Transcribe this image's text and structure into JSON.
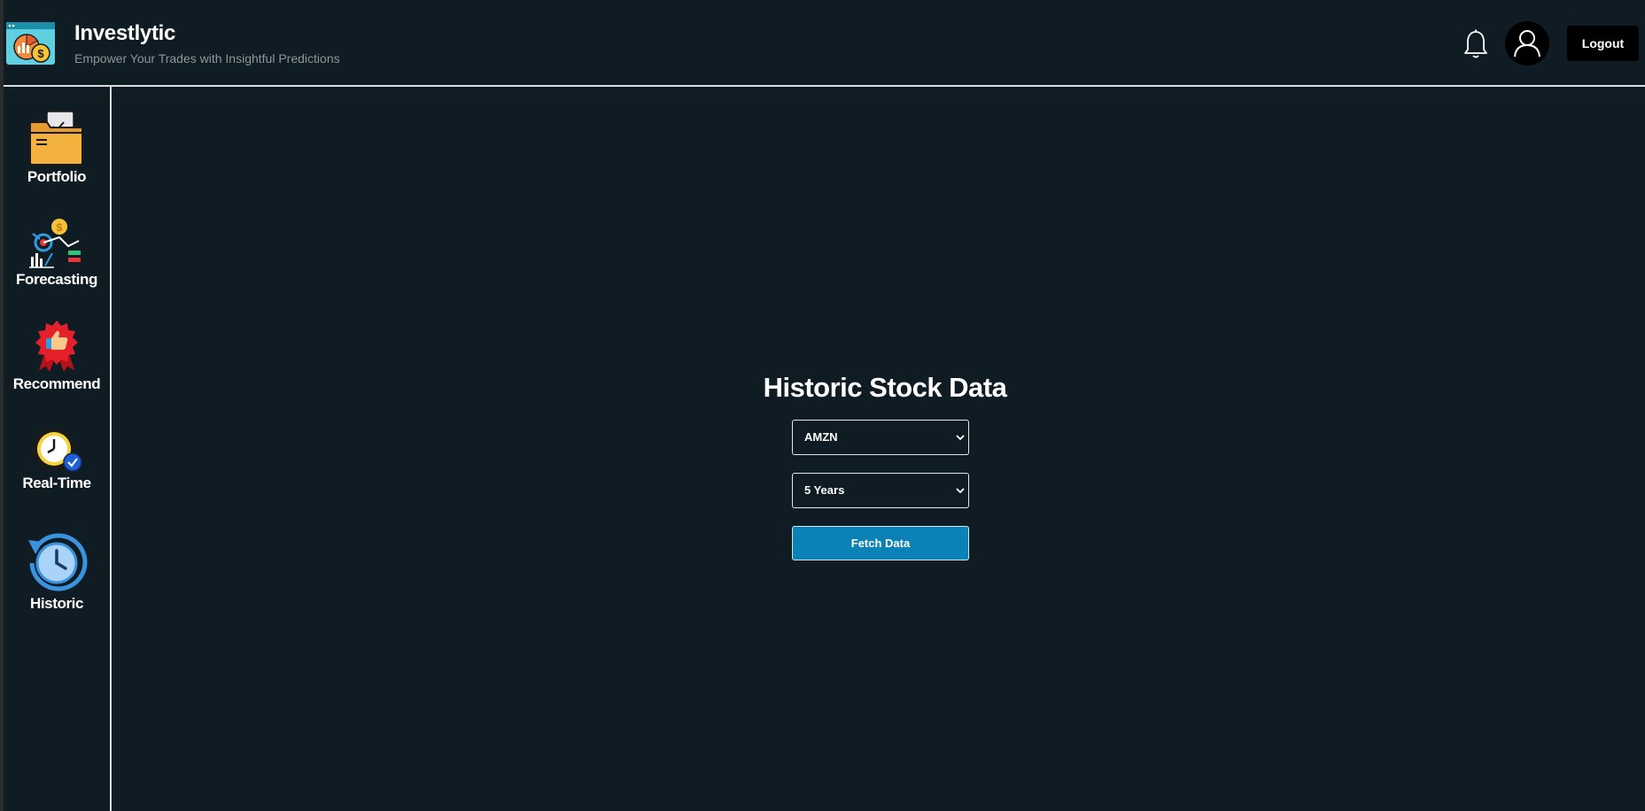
{
  "header": {
    "title": "Investlytic",
    "subtitle": "Empower Your Trades with Insightful Predictions",
    "logout_label": "Logout"
  },
  "sidebar": {
    "items": [
      {
        "label": "Portfolio",
        "icon": "folder-icon"
      },
      {
        "label": "Forecasting",
        "icon": "forecast-chart-icon"
      },
      {
        "label": "Recommend",
        "icon": "thumbs-up-badge-icon"
      },
      {
        "label": "Real-Time",
        "icon": "clock-check-icon"
      },
      {
        "label": "Historic",
        "icon": "history-clock-icon"
      }
    ]
  },
  "main": {
    "title": "Historic Stock Data",
    "ticker_select": {
      "value": "AMZN"
    },
    "period_select": {
      "value": "5 Years"
    },
    "fetch_label": "Fetch Data"
  },
  "colors": {
    "background": "#101c23",
    "accent": "#0a82b5",
    "text": "#ffffff",
    "subtitle": "#8c969b"
  }
}
